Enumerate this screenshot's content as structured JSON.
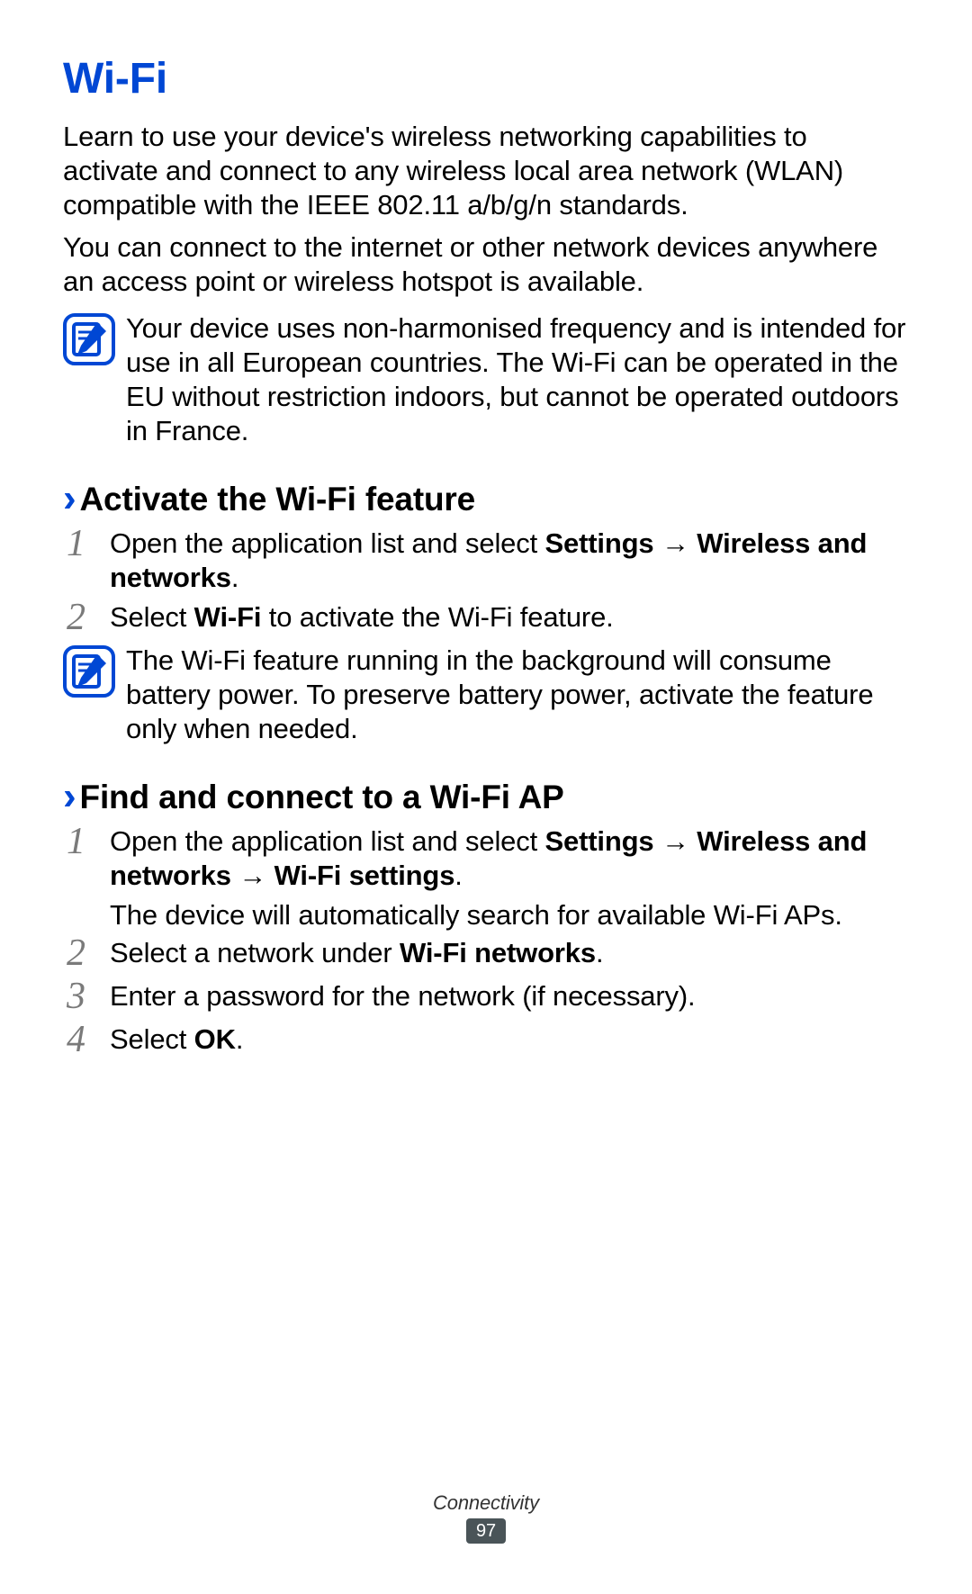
{
  "title": "Wi-Fi",
  "intro1": "Learn to use your device's wireless networking capabilities to activate and connect to any wireless local area network (WLAN) compatible with the IEEE 802.11 a/b/g/n standards.",
  "intro2": "You can connect to the internet or other network devices anywhere an access point or wireless hotspot is available.",
  "note1": "Your device uses non-harmonised frequency and is intended for use in all European countries. The Wi-Fi can be operated in the EU without restriction indoors, but cannot be operated outdoors in France.",
  "section1": {
    "heading": "Activate the Wi-Fi feature",
    "step1_pre": "Open the application list and select ",
    "step1_bold1": "Settings",
    "step1_arrow": " → ",
    "step1_bold2": "Wireless and networks",
    "step1_post": ".",
    "step2_pre": "Select ",
    "step2_bold": "Wi-Fi",
    "step2_post": " to activate the Wi-Fi feature.",
    "note": "The Wi-Fi feature running in the background will consume battery power. To preserve battery power, activate the feature only when needed."
  },
  "section2": {
    "heading": "Find and connect to a Wi-Fi AP",
    "step1_pre": "Open the application list and select ",
    "step1_bold1": "Settings",
    "step1_arrow1": " → ",
    "step1_bold2": "Wireless and networks",
    "step1_arrow2": " → ",
    "step1_bold3": "Wi-Fi settings",
    "step1_post": ".",
    "step1_extra": "The device will automatically search for available Wi-Fi APs.",
    "step2_pre": "Select a network under ",
    "step2_bold": "Wi-Fi networks",
    "step2_post": ".",
    "step3": "Enter a password for the network (if necessary).",
    "step4_pre": "Select ",
    "step4_bold": "OK",
    "step4_post": "."
  },
  "nums": {
    "n1": "1",
    "n2": "2",
    "n3": "3",
    "n4": "4"
  },
  "footer": {
    "section": "Connectivity",
    "page": "97"
  }
}
